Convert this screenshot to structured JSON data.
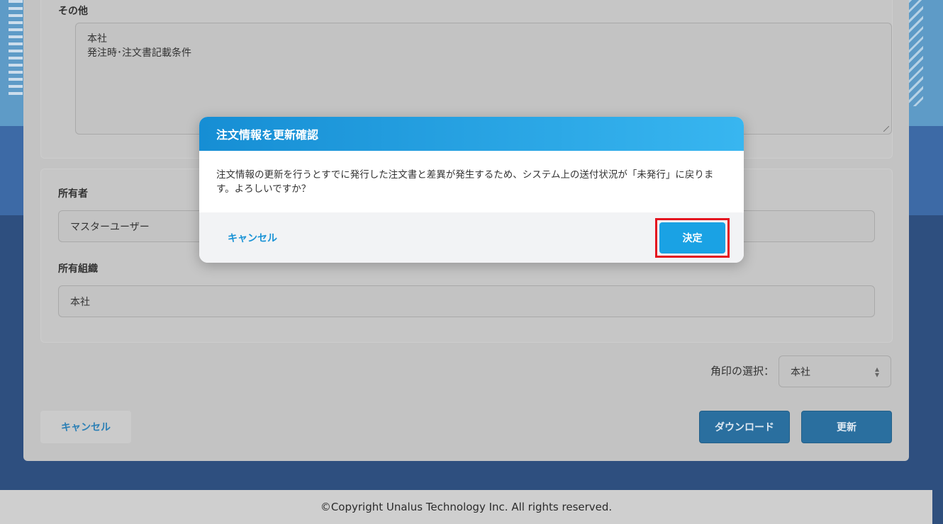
{
  "form": {
    "other_label": "その他",
    "other_lines": [
      "本社",
      "発注時･注文書記載条件"
    ],
    "owner_label": "所有者",
    "owner_value": "マスターユーザー",
    "org_label": "所有組織",
    "org_value": "本社",
    "seal_label": "角印の選択：",
    "seal_value": "本社"
  },
  "actions": {
    "cancel": "キャンセル",
    "download": "ダウンロード",
    "update": "更新"
  },
  "modal": {
    "title": "注文情報を更新確認",
    "message": "注文情報の更新を行うとすでに発行した注文書と差異が発生するため、システム上の送付状況が「未発行」に戻ります。よろしいですか？",
    "cancel": "キャンセル",
    "confirm": "決定"
  },
  "footer": {
    "copyright": "©Copyright Unalus Technology Inc. All rights reserved."
  },
  "colors": {
    "modal_header_start": "#168ed4",
    "modal_header_end": "#38b6f0",
    "confirm_button": "#1aa2e4",
    "highlight": "#e4141f"
  }
}
